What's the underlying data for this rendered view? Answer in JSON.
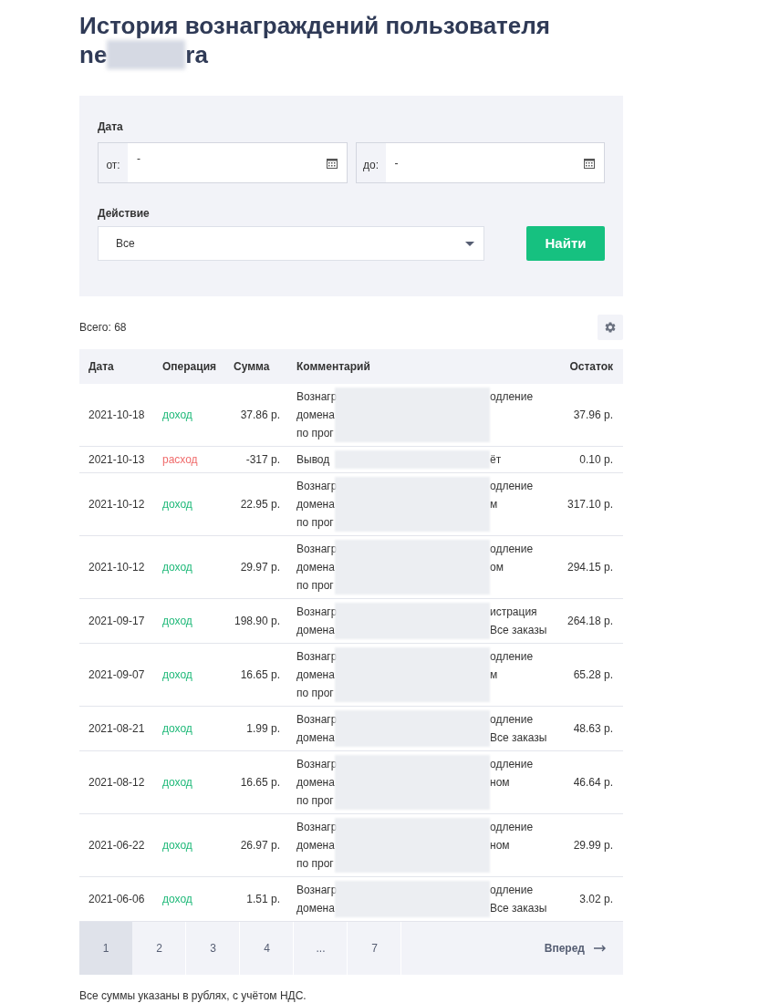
{
  "title": {
    "line1": "История вознаграждений пользователя",
    "username_start": "ne",
    "username_end": "ra"
  },
  "filter": {
    "date_label": "Дата",
    "from": {
      "label": "от:",
      "value": "-"
    },
    "to": {
      "label": "до:",
      "value": "-"
    },
    "action_label": "Действие",
    "action_value": "Все",
    "search_button": "Найти"
  },
  "total": "Всего: 68",
  "table": {
    "columns": [
      "Дата",
      "Операция",
      "Сумма",
      "Комментарий",
      "Остаток"
    ],
    "rows": [
      {
        "date": "2021-10-18",
        "operation": {
          "kind": "income",
          "text": "доход"
        },
        "sum": "37.86 р.",
        "comment_left": [
          "Вознагр",
          "домена",
          "по прог"
        ],
        "comment_right": [
          "одление"
        ],
        "balance": "37.96 р."
      },
      {
        "date": "2021-10-13",
        "operation": {
          "kind": "expense",
          "text": "расход"
        },
        "sum": "-317 р.",
        "comment_left": [
          "Вывод"
        ],
        "comment_right": [
          "ёт"
        ],
        "balance": "0.10 р."
      },
      {
        "date": "2021-10-12",
        "operation": {
          "kind": "income",
          "text": "доход"
        },
        "sum": "22.95 р.",
        "comment_left": [
          "Вознагр",
          "домена",
          "по прог"
        ],
        "comment_right": [
          "одление",
          "м"
        ],
        "balance": "317.10 р."
      },
      {
        "date": "2021-10-12",
        "operation": {
          "kind": "income",
          "text": "доход"
        },
        "sum": "29.97 р.",
        "comment_left": [
          "Вознагр",
          "домена",
          "по прог"
        ],
        "comment_right": [
          "одление",
          "ом"
        ],
        "balance": "294.15 р."
      },
      {
        "date": "2021-09-17",
        "operation": {
          "kind": "income",
          "text": "доход"
        },
        "sum": "198.90 р.",
        "comment_left": [
          "Вознагр",
          "домена"
        ],
        "comment_right": [
          "истрация",
          "Все заказы"
        ],
        "balance": "264.18 р."
      },
      {
        "date": "2021-09-07",
        "operation": {
          "kind": "income",
          "text": "доход"
        },
        "sum": "16.65 р.",
        "comment_left": [
          "Вознагр",
          "домена",
          "по прог"
        ],
        "comment_right": [
          "одление",
          "м"
        ],
        "balance": "65.28 р."
      },
      {
        "date": "2021-08-21",
        "operation": {
          "kind": "income",
          "text": "доход"
        },
        "sum": "1.99 р.",
        "comment_left": [
          "Вознагр",
          "домена"
        ],
        "comment_right": [
          "одление",
          "Все заказы"
        ],
        "balance": "48.63 р."
      },
      {
        "date": "2021-08-12",
        "operation": {
          "kind": "income",
          "text": "доход"
        },
        "sum": "16.65 р.",
        "comment_left": [
          "Вознагр",
          "домена",
          "по прог"
        ],
        "comment_right": [
          "одление",
          "ном"
        ],
        "balance": "46.64 р."
      },
      {
        "date": "2021-06-22",
        "operation": {
          "kind": "income",
          "text": "доход"
        },
        "sum": "26.97 р.",
        "comment_left": [
          "Вознагр",
          "домена",
          "по прог"
        ],
        "comment_right": [
          "одление",
          "ном"
        ],
        "balance": "29.99 р."
      },
      {
        "date": "2021-06-06",
        "operation": {
          "kind": "income",
          "text": "доход"
        },
        "sum": "1.51 р.",
        "comment_left": [
          "Вознагр",
          "домена"
        ],
        "comment_right": [
          "одление",
          "Все заказы"
        ],
        "balance": "3.02 р."
      }
    ]
  },
  "pagination": {
    "pages": [
      {
        "label": "1",
        "selected": true
      },
      {
        "label": "2",
        "selected": false
      },
      {
        "label": "3",
        "selected": false
      },
      {
        "label": "4",
        "selected": false
      },
      {
        "label": "...",
        "selected": false
      },
      {
        "label": "7",
        "selected": false
      }
    ],
    "next": "Вперед"
  },
  "footnote": "Все суммы указаны в рублях, с учётом НДС."
}
